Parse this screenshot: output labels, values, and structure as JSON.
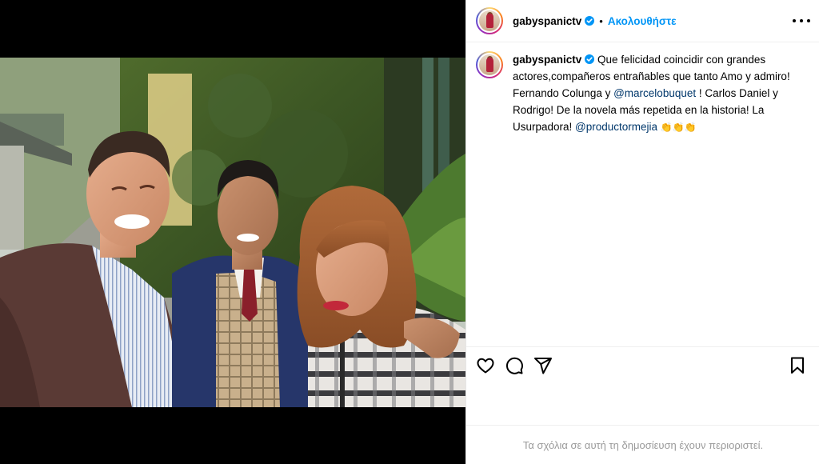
{
  "post": {
    "username": "gabyspanictv",
    "follow_label": "Ακολουθήστε",
    "separator": "•",
    "caption": {
      "part1": "Que felicidad coincidir con grandes actores,compañeros entrañables que tanto Amo y admiro! Fernando Colunga y ",
      "mention1": "@marcelobuquet",
      "part2": " ! Carlos Daniel y Rodrigo! De la novela más repetida en la historia! La Usurpadora! ",
      "mention2": "@productormejia",
      "emoji": "👏👏👏"
    },
    "comments_disabled": "Τα σχόλια σε αυτή τη δημοσίευση έχουν περιοριστεί."
  },
  "icons": {
    "verified": "verified-badge-icon",
    "more": "more-options-icon",
    "like": "heart-icon",
    "comment": "comment-icon",
    "share": "share-icon",
    "save": "bookmark-icon"
  },
  "colors": {
    "accent": "#0095f6",
    "mention": "#00376b",
    "muted": "#9a9a9a",
    "background": "#000000",
    "panel": "#ffffff"
  }
}
